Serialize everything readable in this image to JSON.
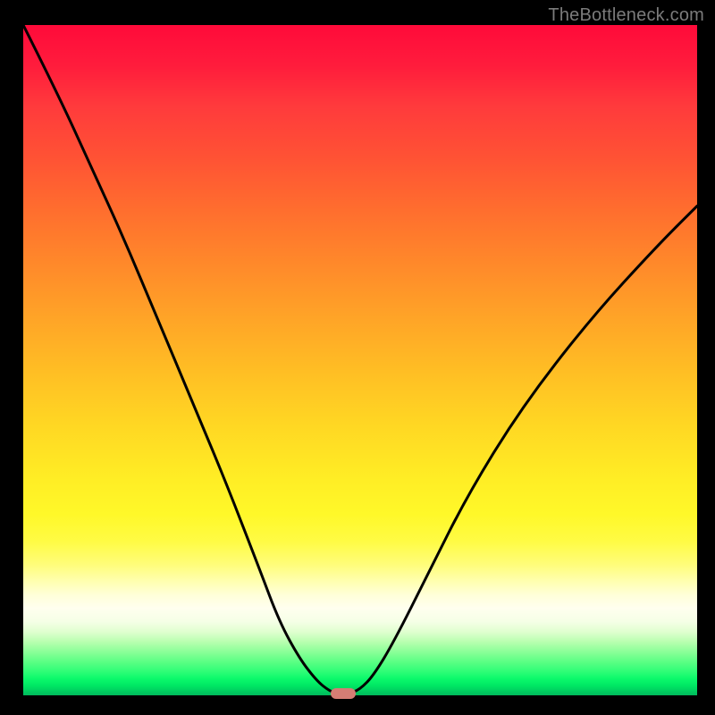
{
  "watermark": "TheBottleneck.com",
  "chart_data": {
    "type": "line",
    "title": "",
    "xlabel": "",
    "ylabel": "",
    "xlim": [
      0,
      100
    ],
    "ylim": [
      0,
      100
    ],
    "grid": false,
    "legend": false,
    "series": [
      {
        "name": "bottleneck-curve",
        "x": [
          0,
          5,
          10,
          15,
          20,
          25,
          30,
          35,
          38,
          41,
          43.5,
          45.5,
          47,
          48,
          50,
          52,
          55,
          60,
          66,
          74,
          84,
          94,
          100
        ],
        "y": [
          100,
          90,
          79,
          68,
          56,
          44,
          32,
          19,
          11,
          5.5,
          2.2,
          0.6,
          0.1,
          0.1,
          0.9,
          3.0,
          8,
          18,
          30,
          43,
          56,
          67,
          73
        ],
        "stroke": "#000000",
        "stroke_width": 3
      }
    ],
    "annotations": [
      {
        "name": "bottleneck-marker",
        "shape": "pill",
        "x": 47.5,
        "y": 0.3,
        "color": "#d57d74"
      }
    ],
    "background_gradient": {
      "direction": "vertical",
      "stops": [
        {
          "pos": 0.0,
          "color": "#ff0a3a"
        },
        {
          "pos": 0.5,
          "color": "#ffbf24"
        },
        {
          "pos": 0.78,
          "color": "#fff829"
        },
        {
          "pos": 0.87,
          "color": "#ffffff"
        },
        {
          "pos": 1.0,
          "color": "#00b95c"
        }
      ]
    }
  }
}
